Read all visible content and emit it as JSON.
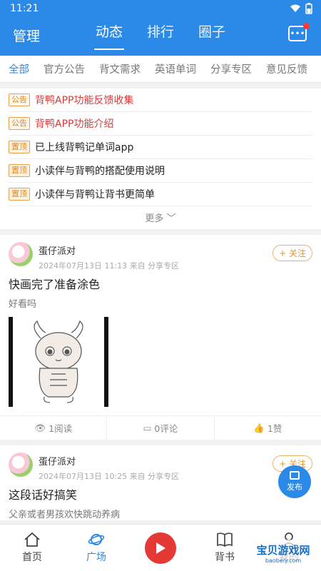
{
  "status": {
    "time": "11:21"
  },
  "header": {
    "left": "管理",
    "tabs": [
      {
        "label": "动态",
        "active": true
      },
      {
        "label": "排行"
      },
      {
        "label": "圈子"
      }
    ]
  },
  "categories": [
    "全部",
    "官方公告",
    "背文需求",
    "英语单词",
    "分享专区",
    "意见反馈"
  ],
  "notices": [
    {
      "badge": "公告",
      "text": "背鸭APP功能反馈收集"
    },
    {
      "badge": "公告",
      "text": "背鸭APP功能介绍"
    },
    {
      "badge": "置顶",
      "text": "已上线背鸭记单词app"
    },
    {
      "badge": "置顶",
      "text": "小读伴与背鸭的搭配使用说明"
    },
    {
      "badge": "置顶",
      "text": "小读伴与背鸭让背书更简单"
    }
  ],
  "more_label": "更多",
  "posts": [
    {
      "author": "蛋仔派对",
      "meta": "2024年07月13日 11:13 来自 分享专区",
      "follow": "+ 关注",
      "title": "快画完了准备涂色",
      "desc": "好看吗",
      "reads": "1阅读",
      "comments": "0评论",
      "likes": "1赞"
    },
    {
      "author": "蛋仔派对",
      "meta": "2024年07月13日 10:25 来自 分享专区",
      "follow": "+ 关注",
      "title": "这段话好搞笑",
      "desc": "父亲或者男孩欢快跳动养病"
    }
  ],
  "publish_label": "发布",
  "bottom_nav": [
    {
      "label": "首页"
    },
    {
      "label": "广场",
      "active": true
    },
    {
      "label": ""
    },
    {
      "label": "背书"
    },
    {
      "label": "我的"
    }
  ],
  "watermark": {
    "text": "宝贝游戏网",
    "sub": "baobeiy.com"
  },
  "colors": {
    "primary": "#2b8ae8",
    "red": "#d83a3a",
    "badge": "#e0872a"
  }
}
